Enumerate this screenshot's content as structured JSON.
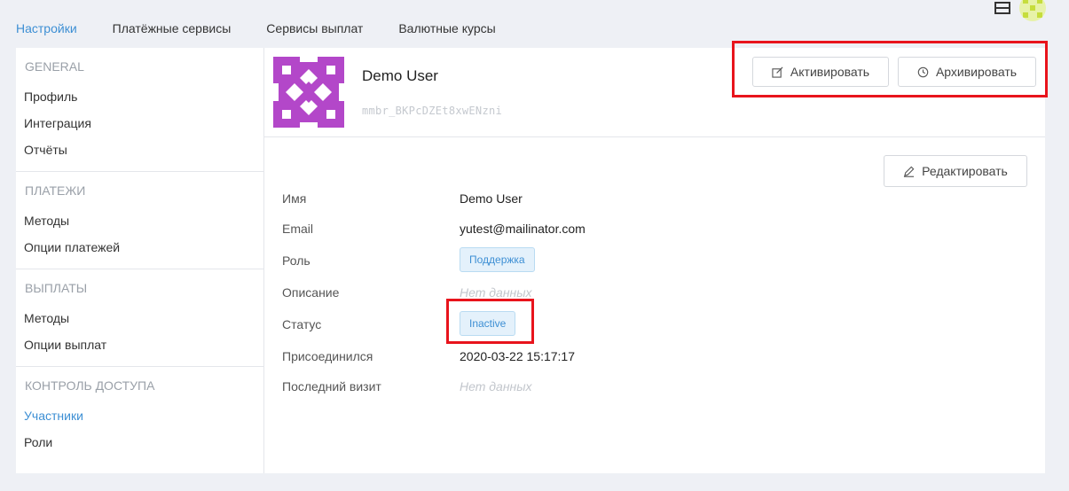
{
  "tabs": [
    {
      "label": "Настройки",
      "active": true
    },
    {
      "label": "Платёжные сервисы",
      "active": false
    },
    {
      "label": "Сервисы выплат",
      "active": false
    },
    {
      "label": "Валютные курсы",
      "active": false
    }
  ],
  "sidebar": {
    "sections": [
      {
        "heading": "GENERAL",
        "items": [
          "Профиль",
          "Интеграция",
          "Отчёты"
        ]
      },
      {
        "heading": "ПЛАТЕЖИ",
        "items": [
          "Методы",
          "Опции платежей"
        ]
      },
      {
        "heading": "ВЫПЛАТЫ",
        "items": [
          "Методы",
          "Опции выплат"
        ]
      },
      {
        "heading": "КОНТРОЛЬ ДОСТУПА",
        "items": [
          "Участники",
          "Роли"
        ]
      }
    ],
    "active_item": "Участники"
  },
  "profile": {
    "name": "Demo User",
    "id": "mmbr_BKPcDZEt8xwENzni"
  },
  "actions": {
    "activate_label": "Активировать",
    "archive_label": "Архивировать",
    "edit_label": "Редактировать"
  },
  "details": {
    "name_label": "Имя",
    "name_value": "Demo User",
    "email_label": "Email",
    "email_value": "yutest@mailinator.com",
    "role_label": "Роль",
    "role_value": "Поддержка",
    "description_label": "Описание",
    "description_value": "Нет данных",
    "status_label": "Статус",
    "status_value": "Inactive",
    "joined_label": "Присоединился",
    "joined_value": "2020-03-22 15:17:17",
    "last_visit_label": "Последний визит",
    "last_visit_value": "Нет данных"
  },
  "colors": {
    "accent": "#3d8fd4",
    "avatar": "#b347c9",
    "highlight": "#e8141c"
  },
  "icons": [
    "book-icon",
    "user-avatar",
    "edit-icon",
    "clock-icon",
    "pencil-icon"
  ]
}
